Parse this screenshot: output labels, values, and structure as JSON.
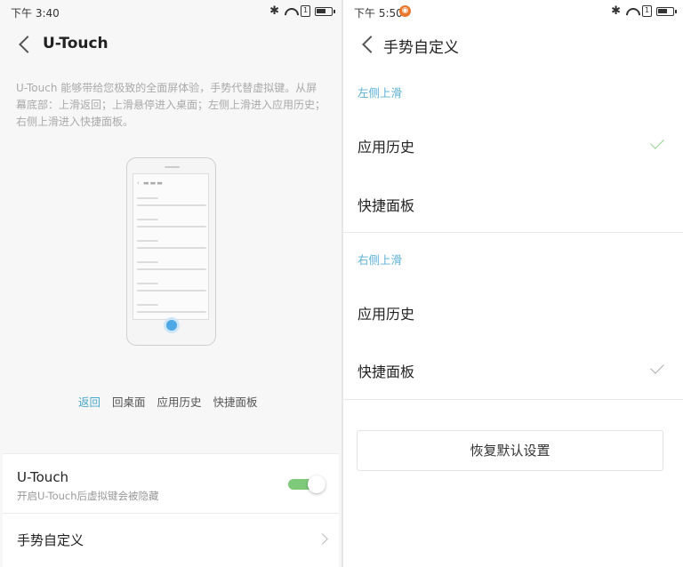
{
  "left": {
    "status": {
      "time": "下午 3:40",
      "sim": "1"
    },
    "title": "U-Touch",
    "description": "U-Touch 能够带给您极致的全面屏体验，手势代替虚拟键。从屏幕底部：上滑返回；上滑悬停进入桌面；左侧上滑进入应用历史；右侧上滑进入快捷面板。",
    "gestures": [
      "返回",
      "回桌面",
      "应用历史",
      "快捷面板"
    ],
    "active_gesture": "返回",
    "utouch": {
      "title": "U-Touch",
      "subtitle": "开启U-Touch后虚拟键会被隐藏",
      "enabled": true
    },
    "custom": {
      "title": "手势自定义"
    }
  },
  "right": {
    "status": {
      "time": "下午 5:50",
      "sim": "1"
    },
    "title": "手势自定义",
    "sections": [
      {
        "label": "左侧上滑",
        "options": [
          {
            "label": "应用历史",
            "selected": true
          },
          {
            "label": "快捷面板",
            "selected": false
          }
        ]
      },
      {
        "label": "右侧上滑",
        "options": [
          {
            "label": "应用历史",
            "selected": false
          },
          {
            "label": "快捷面板",
            "selected": true
          }
        ]
      }
    ],
    "restore_button": "恢复默认设置"
  },
  "colors": {
    "accent": "#5cb0d8",
    "toggle_on": "#7ec97a",
    "check": "#8fcf8c"
  }
}
